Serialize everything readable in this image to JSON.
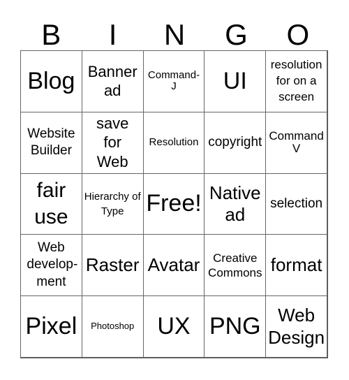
{
  "header": [
    "B",
    "I",
    "N",
    "G",
    "O"
  ],
  "cells": [
    {
      "text": "Blog"
    },
    {
      "text": "Banner ad"
    },
    {
      "text": "Command-J"
    },
    {
      "text": "UI"
    },
    {
      "text": "resolution for on a screen"
    },
    {
      "text": "Website Builder"
    },
    {
      "text": "save for Web"
    },
    {
      "text": "Resolution"
    },
    {
      "text": "copyright"
    },
    {
      "text": "Command V"
    },
    {
      "text": "fair use"
    },
    {
      "text": "Hierarchy of Type"
    },
    {
      "text": "Free!"
    },
    {
      "text": "Native ad"
    },
    {
      "text": "selection"
    },
    {
      "text": "Web develop-ment"
    },
    {
      "text": "Raster"
    },
    {
      "text": "Avatar"
    },
    {
      "text": "Creative Commons"
    },
    {
      "text": "format"
    },
    {
      "text": "Pixel"
    },
    {
      "text": "Photoshop"
    },
    {
      "text": "UX"
    },
    {
      "text": "PNG"
    },
    {
      "text": "Web Design"
    }
  ]
}
